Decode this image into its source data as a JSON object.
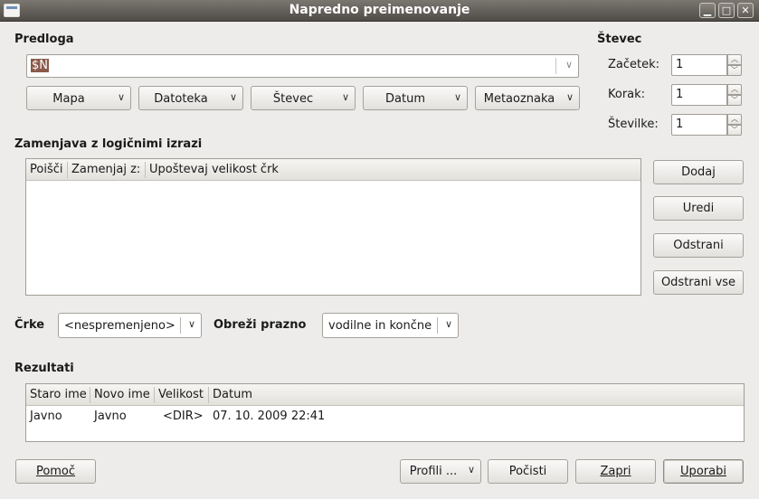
{
  "window": {
    "title": "Napredno preimenovanje"
  },
  "template": {
    "heading": "Predloga",
    "value": "$N",
    "buttons": [
      "Mapa",
      "Datoteka",
      "Števec",
      "Datum",
      "Metaoznaka"
    ]
  },
  "counter": {
    "heading": "Števec",
    "start_label": "Začetek:",
    "start_value": "1",
    "step_label": "Korak:",
    "step_value": "1",
    "digits_label": "Številke:",
    "digits_value": "1"
  },
  "regex": {
    "heading": "Zamenjava z logičnimi izrazi",
    "columns": [
      "Poišči",
      "Zamenjaj z:",
      "Upoštevaj velikost črk"
    ],
    "add": "Dodaj",
    "edit": "Uredi",
    "remove": "Odstrani",
    "remove_all": "Odstrani vse"
  },
  "options": {
    "case_label": "Črke",
    "case_value": "<nespremenjeno>",
    "trim_label": "Obreži prazno",
    "trim_value": "vodilne in končne"
  },
  "results": {
    "heading": "Rezultati",
    "columns": [
      "Staro ime",
      "Novo ime",
      "Velikost",
      "Datum"
    ],
    "rows": [
      {
        "old": "Javno",
        "new": "Javno",
        "size": "<DIR>",
        "date": "07. 10. 2009 22:41"
      }
    ]
  },
  "footer": {
    "help": "Pomoč",
    "profiles": "Profili ...",
    "reset": "Počisti",
    "close": "Zapri",
    "apply": "Uporabi"
  }
}
